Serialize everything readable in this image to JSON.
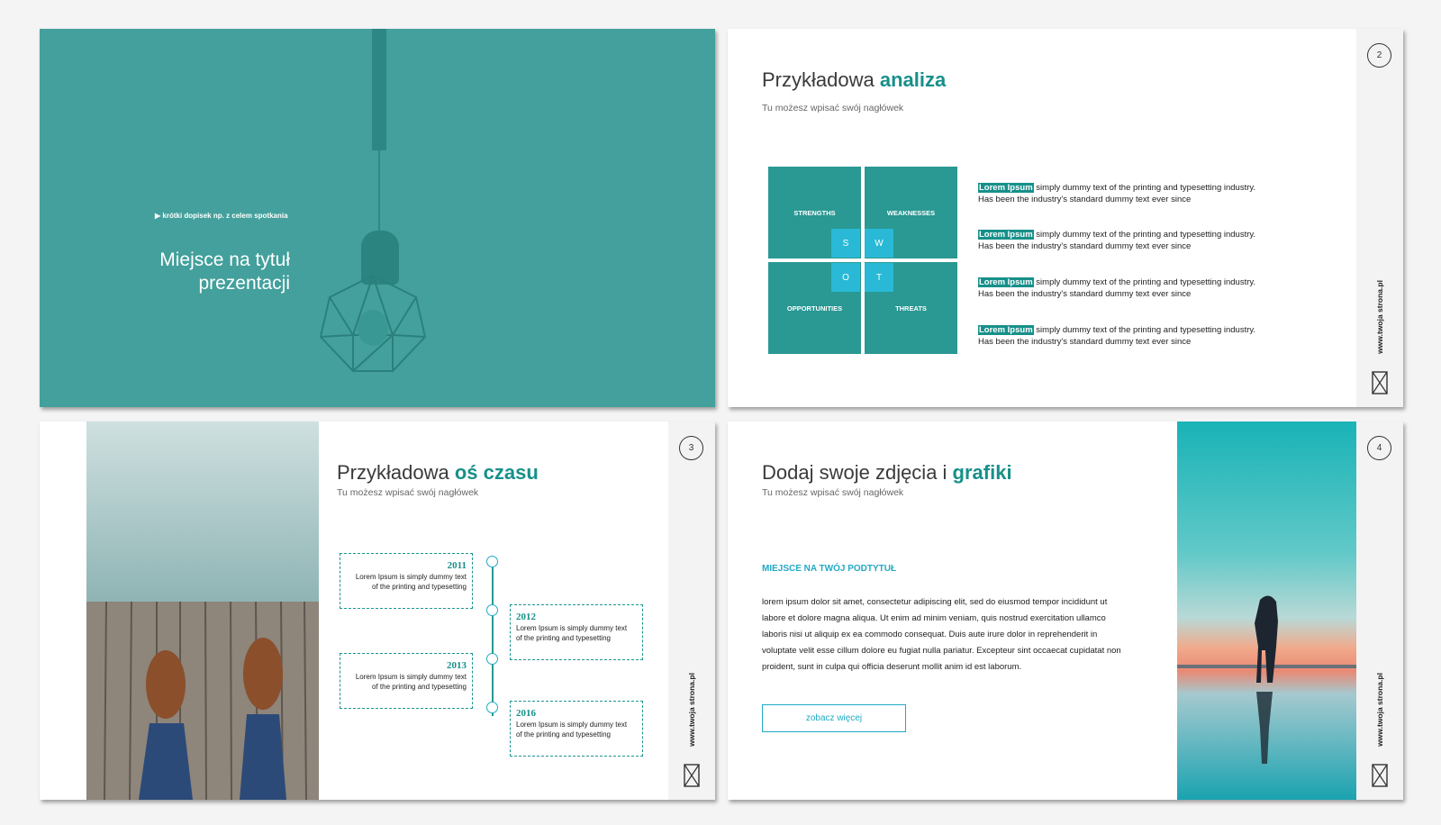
{
  "slide1": {
    "kicker": "▶ krótki dopisek np. z celem spotkania",
    "title_line1": "Miejsce na tytuł",
    "title_line2": "prezentacji"
  },
  "slide2": {
    "page": "2",
    "title_plain": "Przykładowa ",
    "title_accent": "analiza",
    "subtitle": "Tu możesz wpisać swój nagłówek",
    "swot": {
      "strengths": "STRENGTHS",
      "weaknesses": "WEAKNESSES",
      "opportunities": "OPPORTUNITIES",
      "threats": "THREATS",
      "s": "S",
      "w": "W",
      "o": "O",
      "t": "T"
    },
    "points": [
      {
        "hl": "Lorem Ipsum",
        "line1": " simply dummy text of the printing and typesetting industry.",
        "line2": "Has been the industry's standard dummy text ever since"
      },
      {
        "hl": "Lorem Ipsum",
        "line1": " simply dummy text of the printing and typesetting industry.",
        "line2": "Has been the industry's standard dummy text ever since"
      },
      {
        "hl": "Lorem Ipsum",
        "line1": " simply dummy text of the printing and typesetting industry.",
        "line2": "Has been the industry's standard dummy text ever since"
      },
      {
        "hl": "Lorem Ipsum",
        "line1": " simply dummy text of the printing and typesetting industry.",
        "line2": "Has been the industry's standard dummy text ever since"
      }
    ],
    "url": "www.twoja strona.pl"
  },
  "slide3": {
    "page": "3",
    "title_plain": "Przykładowa ",
    "title_accent": "oś czasu",
    "subtitle": "Tu możesz wpisać swój nagłówek",
    "timeline": [
      {
        "year": "2011",
        "line1": "Lorem Ipsum is simply dummy text",
        "line2": "of the printing and typesetting"
      },
      {
        "year": "2012",
        "line1": "Lorem Ipsum is simply dummy text",
        "line2": "of the printing and typesetting"
      },
      {
        "year": "2013",
        "line1": "Lorem Ipsum is simply dummy text",
        "line2": "of the printing and typesetting"
      },
      {
        "year": "2016",
        "line1": "Lorem Ipsum is simply dummy text",
        "line2": "of the printing and typesetting"
      }
    ],
    "url": "www.twoja strona.pl"
  },
  "slide4": {
    "page": "4",
    "title_plain": "Dodaj swoje zdjęcia i ",
    "title_accent": "grafiki",
    "subtitle": "Tu możesz wpisać swój nagłówek",
    "section_title": "MIEJSCE NA TWÓJ PODTYTUŁ",
    "body": "lorem ipsum dolor sit amet, consectetur adipiscing elit, sed do eiusmod tempor incididunt ut labore et dolore magna aliqua. Ut enim ad minim veniam, quis nostrud exercitation ullamco laboris nisi ut aliquip ex ea commodo consequat. Duis aute irure dolor in reprehenderit in voluptate velit esse cillum dolore eu fugiat nulla pariatur. Excepteur sint occaecat cupidatat non proident, sunt in culpa qui officia deserunt mollit anim id est laborum.",
    "button": "zobacz więcej",
    "url": "www.twoja strona.pl"
  }
}
